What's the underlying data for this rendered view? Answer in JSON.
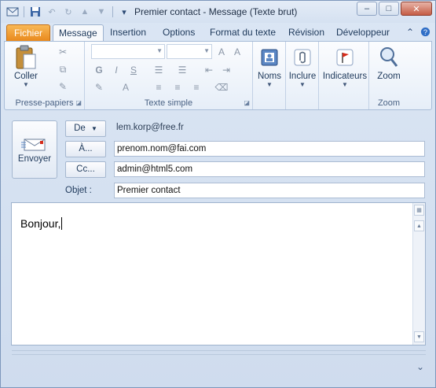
{
  "window": {
    "title": "Premier contact  -  Message (Texte brut)",
    "minimize": "‒",
    "maximize": "□",
    "close": "✕"
  },
  "tabs": {
    "file": "Fichier",
    "items": [
      "Message",
      "Insertion",
      "Options",
      "Format du texte",
      "Révision",
      "Développeur"
    ],
    "active": "Message"
  },
  "ribbon": {
    "clipboard": {
      "paste_label": "Coller",
      "group_label": "Presse-papiers"
    },
    "basic_text": {
      "group_label": "Texte simple"
    },
    "names": {
      "label": "Noms"
    },
    "include": {
      "label": "Inclure"
    },
    "tags": {
      "label": "Indicateurs"
    },
    "zoom": {
      "button_label": "Zoom",
      "group_label": "Zoom"
    }
  },
  "header": {
    "send_label": "Envoyer",
    "from_label": "De",
    "from_value": "lem.korp@free.fr",
    "to_label": "À...",
    "to_value": "prenom.nom@fai.com",
    "cc_label": "Cc...",
    "cc_value": "admin@html5.com",
    "subject_label": "Objet :",
    "subject_value": "Premier contact"
  },
  "body": {
    "text": "Bonjour,"
  },
  "colors": {
    "file_tab": "#e9891d",
    "accent": "#1e395b"
  }
}
